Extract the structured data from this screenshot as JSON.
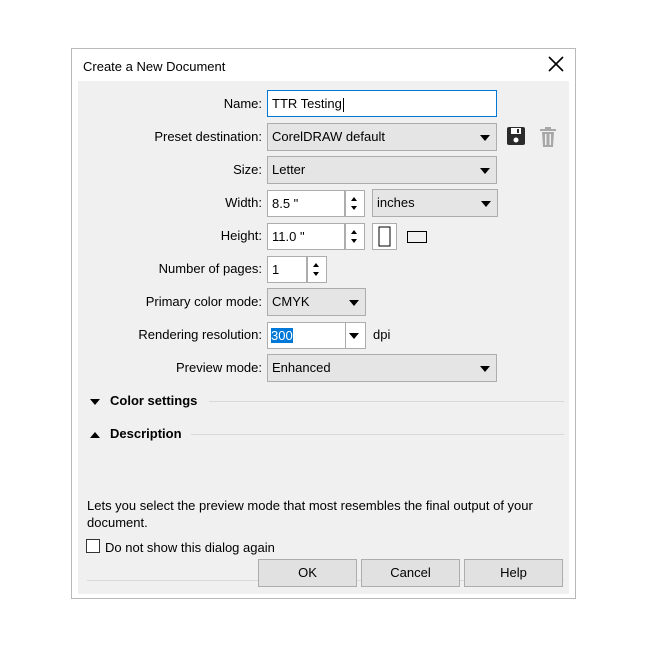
{
  "dialog": {
    "title": "Create a New Document",
    "close_icon": "close-icon"
  },
  "form": {
    "name": {
      "label": "Name:",
      "value": "TTR Testing"
    },
    "preset_destination": {
      "label": "Preset destination:",
      "value": "CorelDRAW default",
      "save_icon": "floppy-disk-icon",
      "delete_icon": "trash-icon"
    },
    "size": {
      "label": "Size:",
      "value": "Letter"
    },
    "width": {
      "label": "Width:",
      "value": "8.5 \"",
      "unit": "inches"
    },
    "height": {
      "label": "Height:",
      "value": "11.0 \"",
      "portrait_icon": "portrait-page-icon",
      "landscape_icon": "landscape-page-icon"
    },
    "pages": {
      "label": "Number of pages:",
      "value": "1"
    },
    "color_mode": {
      "label": "Primary color mode:",
      "value": "CMYK"
    },
    "resolution": {
      "label": "Rendering resolution:",
      "value": "300",
      "unit": "dpi"
    },
    "preview_mode": {
      "label": "Preview mode:",
      "value": "Enhanced"
    }
  },
  "sections": {
    "color_settings": "Color settings",
    "description": "Description"
  },
  "description_text": "Lets you select the preview mode that most resembles the final output of your document.",
  "footer": {
    "checkbox_label": "Do not show this dialog again",
    "ok": "OK",
    "cancel": "Cancel",
    "help": "Help"
  },
  "colors": {
    "accent": "#0078d7",
    "background": "#f0f0f0"
  }
}
